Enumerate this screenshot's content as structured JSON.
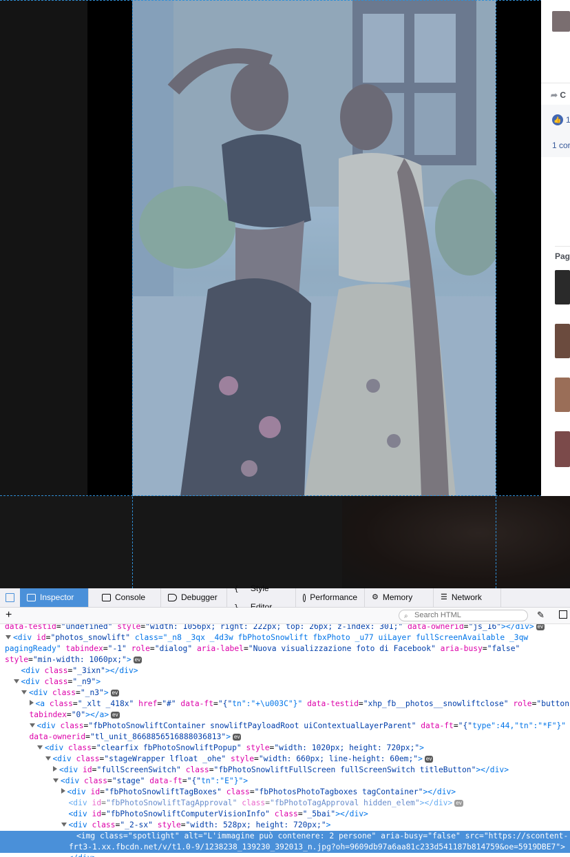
{
  "devtools": {
    "tabs": [
      {
        "label": "Inspector",
        "icon": "inspector-icon",
        "active": true
      },
      {
        "label": "Console",
        "icon": "console-icon"
      },
      {
        "label": "Debugger",
        "icon": "debugger-icon"
      },
      {
        "label": "Style Editor",
        "icon": "style-editor-icon"
      },
      {
        "label": "Performance",
        "icon": "performance-icon"
      },
      {
        "label": "Memory",
        "icon": "memory-icon"
      },
      {
        "label": "Network",
        "icon": "network-icon"
      }
    ],
    "search_placeholder": "Search HTML",
    "ev_badge": "ev",
    "lines": [
      {
        "indent": 0,
        "html": "data-testid=\"undefined\" style=\"width: 1056px; right: 222px; top: 26px; z-index: 301;\" data-ownerid=\"js_16\"></div>"
      },
      {
        "indent": 0,
        "html": "<div id=\"photos_snowlift\" class=\"_n8 _3qx _4d3w fbPhotoSnowlift fbxPhoto _u77 uiLayer fullScreenAvailable _3qw"
      },
      {
        "indent": 0,
        "html": "pagingReady\" tabindex=\"-1\" role=\"dialog\" aria-label=\"Nuova visualizzazione foto di Facebook\" aria-busy=\"false\""
      },
      {
        "indent": 0,
        "html": "style=\"min-width: 1060px;\">"
      },
      {
        "indent": 1,
        "html": "<div class=\"_3ixn\"></div>"
      },
      {
        "indent": 1,
        "html": "<div class=\"_n9\">"
      },
      {
        "indent": 2,
        "html": "<div class=\"_n3\">"
      },
      {
        "indent": 3,
        "html": "<a class=\"_xlt _418x\" href=\"#\" data-ft=\"{\"tn\":\"+\\u003C\"}\" data-testid=\"xhp_fb__photos__snowliftclose\" role=\"button\""
      },
      {
        "indent": 3,
        "html": "tabindex=\"0\"></a>"
      },
      {
        "indent": 3,
        "html": "<div class=\"fbPhotoSnowliftContainer snowliftPayloadRoot uiContextualLayerParent\" data-ft=\"{\"type\":44,\"tn\":\"*F\"}\""
      },
      {
        "indent": 3,
        "html": "data-ownerid=\"tl_unit_8668856516888036813\">"
      },
      {
        "indent": 4,
        "html": "<div class=\"clearfix fbPhotoSnowliftPopup\" style=\"width: 1020px; height: 720px;\">"
      },
      {
        "indent": 5,
        "html": "<div class=\"stageWrapper lfloat _ohe\" style=\"width: 660px; line-height: 60em;\">"
      },
      {
        "indent": 6,
        "html": "<div id=\"fullScreenSwitch\" class=\"fbPhotoSnowliftFullScreen fullScreenSwitch titleButton\"></div>"
      },
      {
        "indent": 6,
        "html": "<div class=\"stage\" data-ft=\"{\"tn\":\"E\"}\">"
      },
      {
        "indent": 7,
        "html": "<div id=\"fbPhotoSnowliftTagBoxes\" class=\"fbPhotosPhotoTagboxes tagContainer\"></div>"
      },
      {
        "indent": 7,
        "html": "<div id=\"fbPhotoSnowliftTagApproval\" class=\"fbPhotoTagApproval hidden_elem\"></div>"
      },
      {
        "indent": 7,
        "html": "<div id=\"fbPhotoSnowliftComputerVisionInfo\" class=\"_5bai\"></div>"
      },
      {
        "indent": 7,
        "html": "<div class=\"_2-sx\" style=\"width: 528px; height: 720px;\">"
      },
      {
        "indent": 8,
        "html": "<img class=\"spotlight\" alt=\"L'immagine può contenere: 2 persone\" aria-busy=\"false\" src=\"https://scontent-"
      },
      {
        "indent": 8,
        "html": "frt3-1.xx.fbcdn.net/v/t1.0-9/1238238_139230_392013_n.jpg?oh=9609db97a6aa81c233d541187b814759&oe=5919DBE7\">"
      },
      {
        "indent": 7,
        "html": "</div>"
      }
    ]
  },
  "rightcol": {
    "share_label": "C",
    "like_count": "1",
    "comment_label": "1 cor",
    "pages_label": "Pag"
  },
  "colors": {
    "devtools_accent": "#4a90d9",
    "tag": "#0074e8",
    "attr_name": "#dd00a9",
    "attr_value": "#003eaa"
  }
}
